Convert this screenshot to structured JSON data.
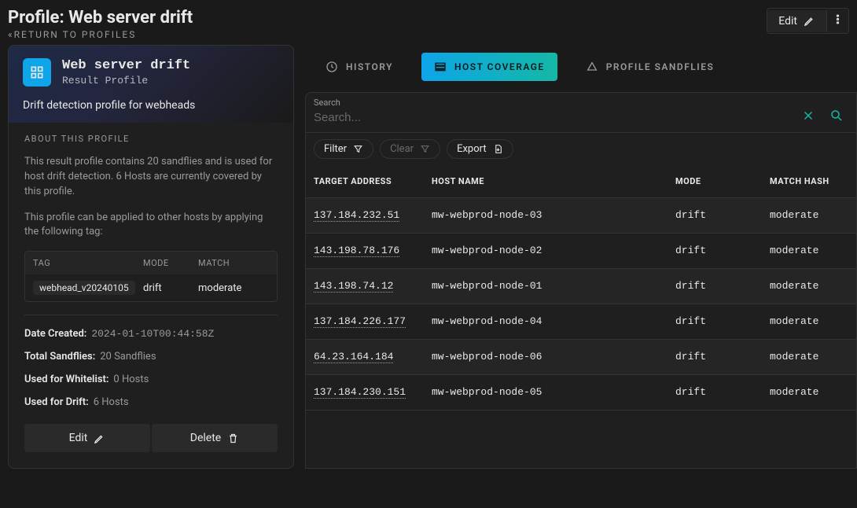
{
  "header": {
    "title": "Profile: Web server drift",
    "return_label": "RETURN TO PROFILES",
    "edit_label": "Edit"
  },
  "profile": {
    "name": "Web server drift",
    "subtitle": "Result Profile",
    "description": "Drift detection profile for webheads",
    "about_label": "ABOUT THIS PROFILE",
    "about_text_1": "This result profile contains 20 sandflies and is used for host drift detection. 6 Hosts are currently covered by this profile.",
    "about_text_2": "This profile can be applied to other hosts by applying the following tag:",
    "tag_table": {
      "headers": {
        "tag": "TAG",
        "mode": "MODE",
        "match": "MATCH"
      },
      "row": {
        "tag": "webhead_v20240105",
        "mode": "drift",
        "match": "moderate"
      }
    },
    "meta": {
      "date_created_label": "Date Created:",
      "date_created_value": "2024-01-10T00:44:58Z",
      "total_sandflies_label": "Total Sandflies:",
      "total_sandflies_value": "20 Sandflies",
      "whitelist_label": "Used for Whitelist:",
      "whitelist_value": "0 Hosts",
      "drift_label": "Used for Drift:",
      "drift_value": "6 Hosts"
    },
    "actions": {
      "edit": "Edit",
      "delete": "Delete"
    }
  },
  "tabs": {
    "history": "HISTORY",
    "host_coverage": "HOST COVERAGE",
    "profile_sandflies": "PROFILE SANDFLIES"
  },
  "search": {
    "label": "Search",
    "placeholder": "Search..."
  },
  "toolbar": {
    "filter": "Filter",
    "clear": "Clear",
    "export": "Export"
  },
  "table": {
    "headers": {
      "target": "TARGET ADDRESS",
      "host": "HOST NAME",
      "mode": "MODE",
      "match": "MATCH HASH"
    },
    "rows": [
      {
        "target": "137.184.232.51",
        "host": "mw-webprod-node-03",
        "mode": "drift",
        "match": "moderate"
      },
      {
        "target": "143.198.78.176",
        "host": "mw-webprod-node-02",
        "mode": "drift",
        "match": "moderate"
      },
      {
        "target": "143.198.74.12",
        "host": "mw-webprod-node-01",
        "mode": "drift",
        "match": "moderate"
      },
      {
        "target": "137.184.226.177",
        "host": "mw-webprod-node-04",
        "mode": "drift",
        "match": "moderate"
      },
      {
        "target": "64.23.164.184",
        "host": "mw-webprod-node-06",
        "mode": "drift",
        "match": "moderate"
      },
      {
        "target": "137.184.230.151",
        "host": "mw-webprod-node-05",
        "mode": "drift",
        "match": "moderate"
      }
    ]
  }
}
